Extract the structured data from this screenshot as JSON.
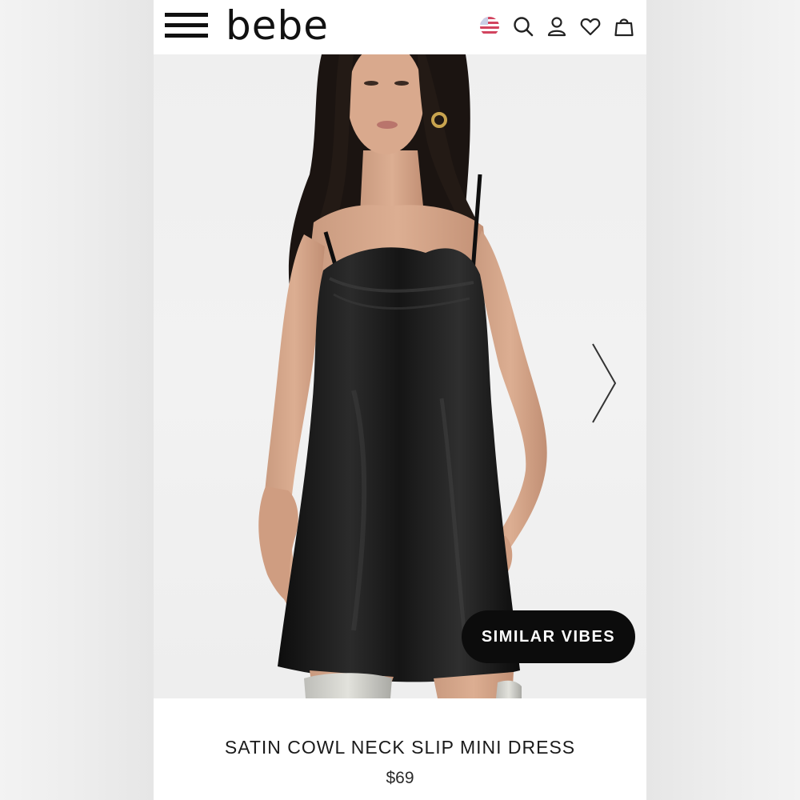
{
  "header": {
    "logo_text": "bebe",
    "icons": [
      "menu-icon",
      "flag-icon",
      "search-icon",
      "account-icon",
      "wishlist-icon",
      "bag-icon"
    ]
  },
  "hero": {
    "image_alt": "Model wearing black satin cowl neck slip mini dress",
    "next_icon": "chevron-right-icon",
    "similar_button_label": "SIMILAR VIBES"
  },
  "product": {
    "name": "SATIN COWL NECK SLIP MINI DRESS",
    "price": "$69"
  },
  "colors": {
    "background": "#ffffff",
    "button_bg": "#0c0c0c",
    "button_text": "#ffffff",
    "flag_red": "#d2445f"
  }
}
